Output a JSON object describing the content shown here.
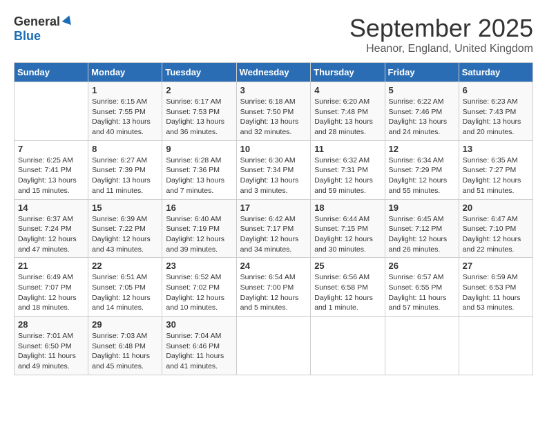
{
  "header": {
    "logo_general": "General",
    "logo_blue": "Blue",
    "month": "September 2025",
    "location": "Heanor, England, United Kingdom"
  },
  "days_of_week": [
    "Sunday",
    "Monday",
    "Tuesday",
    "Wednesday",
    "Thursday",
    "Friday",
    "Saturday"
  ],
  "weeks": [
    [
      {
        "day": "",
        "info": ""
      },
      {
        "day": "1",
        "info": "Sunrise: 6:15 AM\nSunset: 7:55 PM\nDaylight: 13 hours\nand 40 minutes."
      },
      {
        "day": "2",
        "info": "Sunrise: 6:17 AM\nSunset: 7:53 PM\nDaylight: 13 hours\nand 36 minutes."
      },
      {
        "day": "3",
        "info": "Sunrise: 6:18 AM\nSunset: 7:50 PM\nDaylight: 13 hours\nand 32 minutes."
      },
      {
        "day": "4",
        "info": "Sunrise: 6:20 AM\nSunset: 7:48 PM\nDaylight: 13 hours\nand 28 minutes."
      },
      {
        "day": "5",
        "info": "Sunrise: 6:22 AM\nSunset: 7:46 PM\nDaylight: 13 hours\nand 24 minutes."
      },
      {
        "day": "6",
        "info": "Sunrise: 6:23 AM\nSunset: 7:43 PM\nDaylight: 13 hours\nand 20 minutes."
      }
    ],
    [
      {
        "day": "7",
        "info": "Sunrise: 6:25 AM\nSunset: 7:41 PM\nDaylight: 13 hours\nand 15 minutes."
      },
      {
        "day": "8",
        "info": "Sunrise: 6:27 AM\nSunset: 7:39 PM\nDaylight: 13 hours\nand 11 minutes."
      },
      {
        "day": "9",
        "info": "Sunrise: 6:28 AM\nSunset: 7:36 PM\nDaylight: 13 hours\nand 7 minutes."
      },
      {
        "day": "10",
        "info": "Sunrise: 6:30 AM\nSunset: 7:34 PM\nDaylight: 13 hours\nand 3 minutes."
      },
      {
        "day": "11",
        "info": "Sunrise: 6:32 AM\nSunset: 7:31 PM\nDaylight: 12 hours\nand 59 minutes."
      },
      {
        "day": "12",
        "info": "Sunrise: 6:34 AM\nSunset: 7:29 PM\nDaylight: 12 hours\nand 55 minutes."
      },
      {
        "day": "13",
        "info": "Sunrise: 6:35 AM\nSunset: 7:27 PM\nDaylight: 12 hours\nand 51 minutes."
      }
    ],
    [
      {
        "day": "14",
        "info": "Sunrise: 6:37 AM\nSunset: 7:24 PM\nDaylight: 12 hours\nand 47 minutes."
      },
      {
        "day": "15",
        "info": "Sunrise: 6:39 AM\nSunset: 7:22 PM\nDaylight: 12 hours\nand 43 minutes."
      },
      {
        "day": "16",
        "info": "Sunrise: 6:40 AM\nSunset: 7:19 PM\nDaylight: 12 hours\nand 39 minutes."
      },
      {
        "day": "17",
        "info": "Sunrise: 6:42 AM\nSunset: 7:17 PM\nDaylight: 12 hours\nand 34 minutes."
      },
      {
        "day": "18",
        "info": "Sunrise: 6:44 AM\nSunset: 7:15 PM\nDaylight: 12 hours\nand 30 minutes."
      },
      {
        "day": "19",
        "info": "Sunrise: 6:45 AM\nSunset: 7:12 PM\nDaylight: 12 hours\nand 26 minutes."
      },
      {
        "day": "20",
        "info": "Sunrise: 6:47 AM\nSunset: 7:10 PM\nDaylight: 12 hours\nand 22 minutes."
      }
    ],
    [
      {
        "day": "21",
        "info": "Sunrise: 6:49 AM\nSunset: 7:07 PM\nDaylight: 12 hours\nand 18 minutes."
      },
      {
        "day": "22",
        "info": "Sunrise: 6:51 AM\nSunset: 7:05 PM\nDaylight: 12 hours\nand 14 minutes."
      },
      {
        "day": "23",
        "info": "Sunrise: 6:52 AM\nSunset: 7:02 PM\nDaylight: 12 hours\nand 10 minutes."
      },
      {
        "day": "24",
        "info": "Sunrise: 6:54 AM\nSunset: 7:00 PM\nDaylight: 12 hours\nand 5 minutes."
      },
      {
        "day": "25",
        "info": "Sunrise: 6:56 AM\nSunset: 6:58 PM\nDaylight: 12 hours\nand 1 minute."
      },
      {
        "day": "26",
        "info": "Sunrise: 6:57 AM\nSunset: 6:55 PM\nDaylight: 11 hours\nand 57 minutes."
      },
      {
        "day": "27",
        "info": "Sunrise: 6:59 AM\nSunset: 6:53 PM\nDaylight: 11 hours\nand 53 minutes."
      }
    ],
    [
      {
        "day": "28",
        "info": "Sunrise: 7:01 AM\nSunset: 6:50 PM\nDaylight: 11 hours\nand 49 minutes."
      },
      {
        "day": "29",
        "info": "Sunrise: 7:03 AM\nSunset: 6:48 PM\nDaylight: 11 hours\nand 45 minutes."
      },
      {
        "day": "30",
        "info": "Sunrise: 7:04 AM\nSunset: 6:46 PM\nDaylight: 11 hours\nand 41 minutes."
      },
      {
        "day": "",
        "info": ""
      },
      {
        "day": "",
        "info": ""
      },
      {
        "day": "",
        "info": ""
      },
      {
        "day": "",
        "info": ""
      }
    ]
  ]
}
